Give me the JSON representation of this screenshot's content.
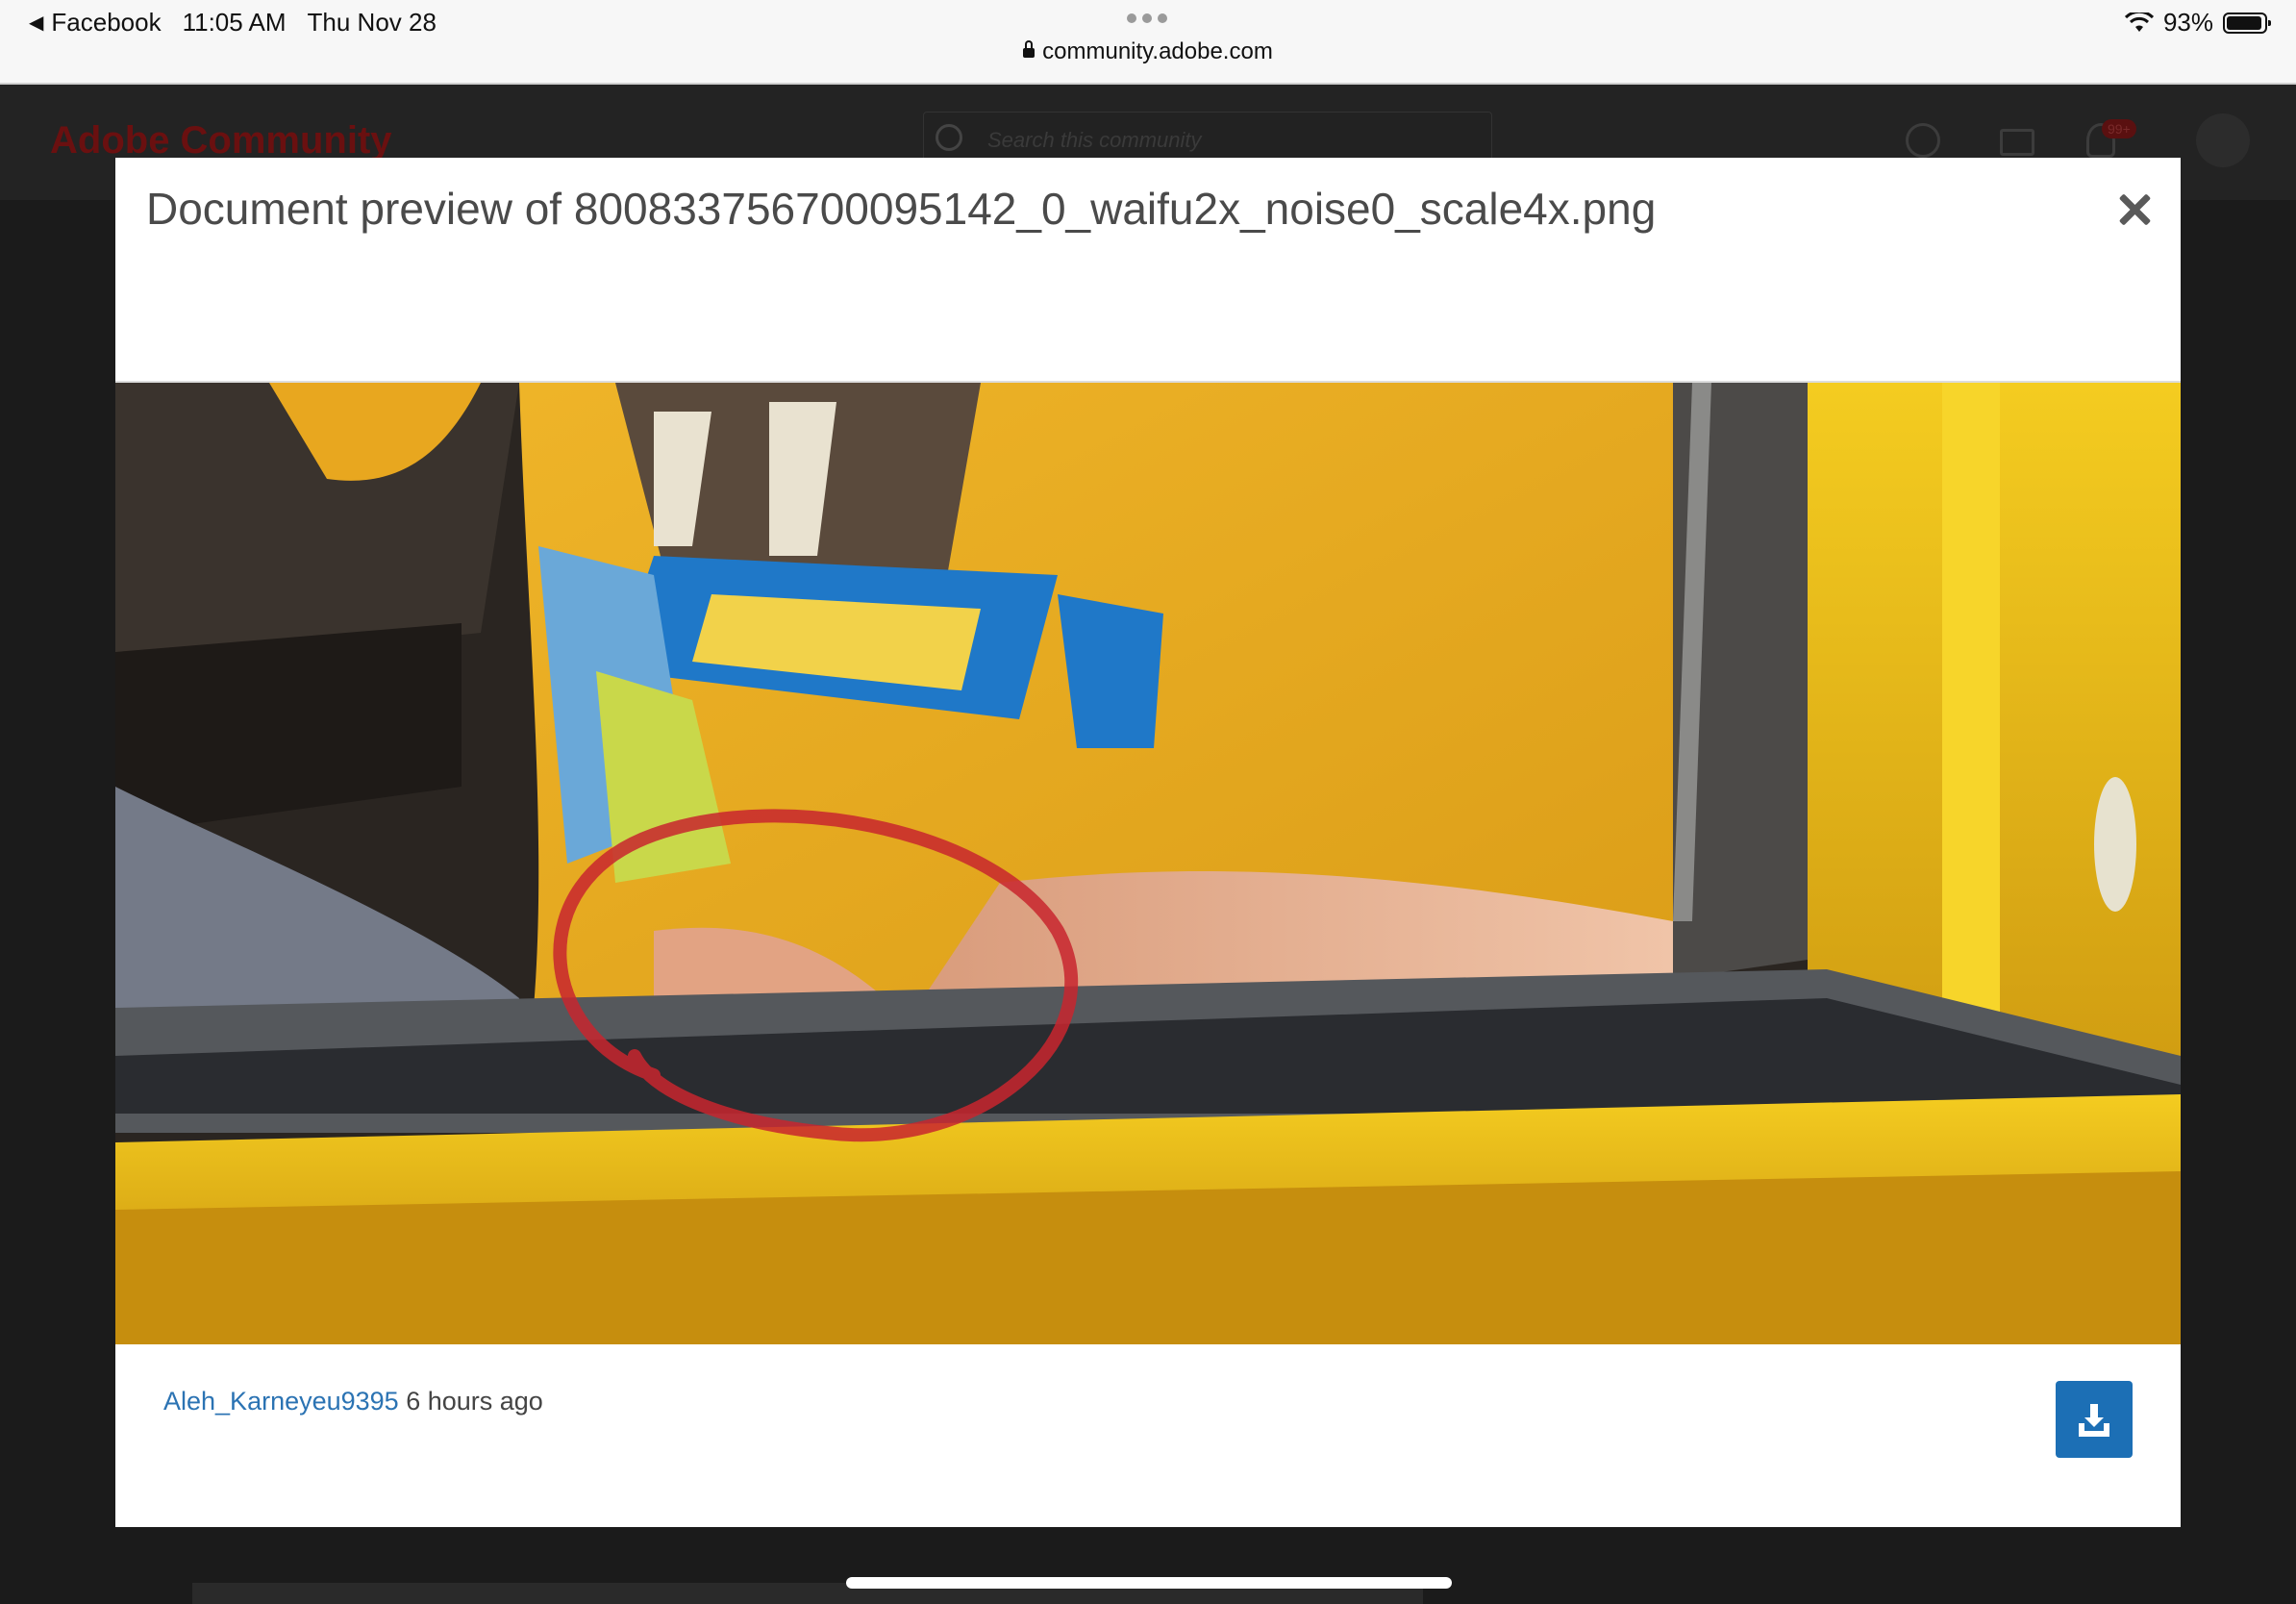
{
  "status_bar": {
    "back_app": "Facebook",
    "time": "11:05 AM",
    "date": "Thu Nov 28",
    "url": "community.adobe.com",
    "battery": "93%"
  },
  "background": {
    "brand": "Adobe Community",
    "search_placeholder": "Search this community",
    "notification_count": "99+"
  },
  "modal": {
    "title": "Document preview of 800833756700095142_0_waifu2x_noise0_scale4x.png",
    "author": "Aleh_Karneyeu9395",
    "timestamp": "6 hours ago"
  },
  "colors": {
    "accent": "#1c6fb5",
    "link": "#2b73b3",
    "annotation": "#c8262e",
    "car_yellow": "#f2c20e",
    "shirt_yellow": "#e9ae22"
  },
  "icons": {
    "close": "close-icon",
    "download": "download-icon",
    "lock": "lock-icon",
    "wifi": "wifi-icon",
    "battery": "battery-icon"
  }
}
